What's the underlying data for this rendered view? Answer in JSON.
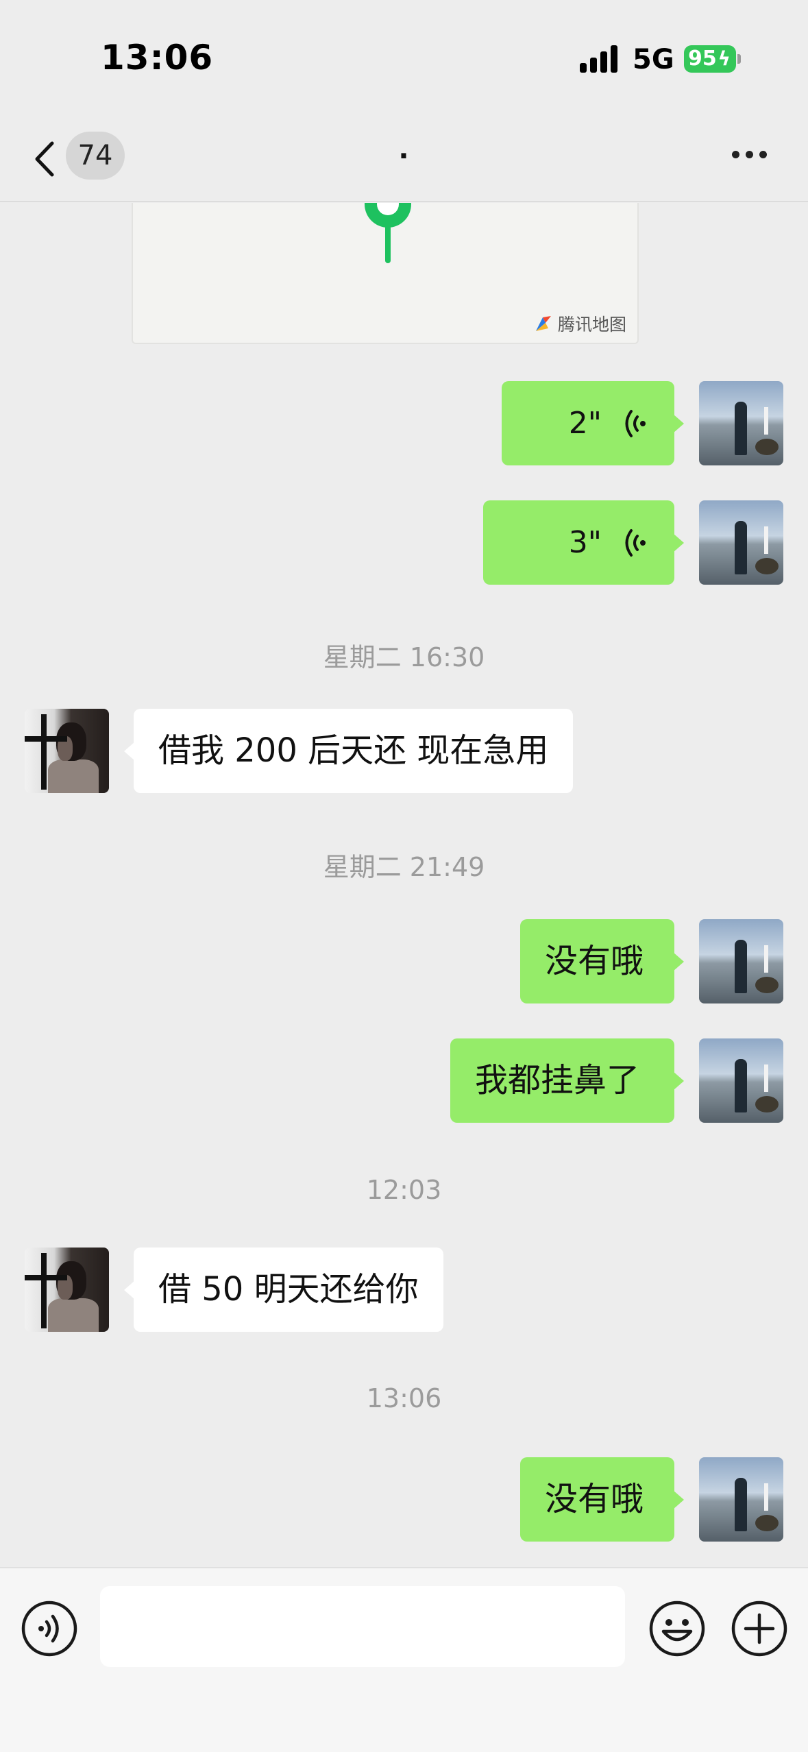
{
  "status_bar": {
    "time": "13:06",
    "network": "5G",
    "battery": "95"
  },
  "nav": {
    "unread_count": "74",
    "title": "."
  },
  "map_card": {
    "provider": "腾讯地图"
  },
  "messages": [
    {
      "type": "voice",
      "from": "self",
      "duration": "2\""
    },
    {
      "type": "voice",
      "from": "self",
      "duration": "3\""
    },
    {
      "type": "time",
      "text": "星期二 16:30"
    },
    {
      "type": "text",
      "from": "other",
      "text": "借我 200 后天还 现在急用"
    },
    {
      "type": "time",
      "text": "星期二 21:49"
    },
    {
      "type": "text",
      "from": "self",
      "text": "没有哦"
    },
    {
      "type": "text",
      "from": "self",
      "text": "我都挂鼻了"
    },
    {
      "type": "time",
      "text": "12:03"
    },
    {
      "type": "text",
      "from": "other",
      "text": "借 50 明天还给你"
    },
    {
      "type": "time",
      "text": "13:06"
    },
    {
      "type": "text",
      "from": "self",
      "text": "没有哦"
    }
  ],
  "input_bar": {
    "value": "",
    "placeholder": ""
  },
  "colors": {
    "outgoing_bubble": "#95ec69",
    "incoming_bubble": "#ffffff",
    "background": "#ededed",
    "map_pin": "#1ec15f"
  },
  "icons": [
    "chevron-left-icon",
    "more-icon",
    "map-pin-icon",
    "voice-wave-icon",
    "voice-input-icon",
    "emoji-icon",
    "plus-icon"
  ]
}
